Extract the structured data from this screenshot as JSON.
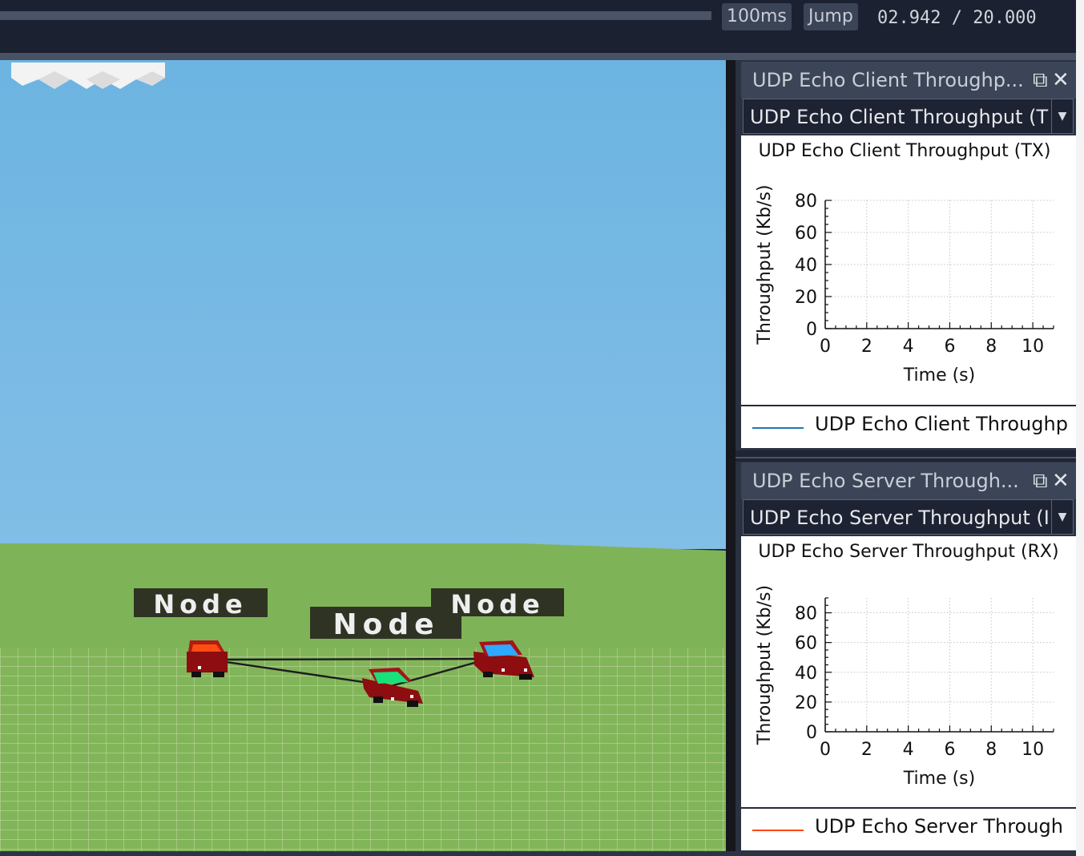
{
  "toolbar": {
    "step_label": "100ms",
    "jump_label": "Jump",
    "time_readout": "02.942 / 20.000"
  },
  "scene": {
    "node_labels": [
      "Node",
      "Node",
      "Node"
    ],
    "sky_color": "#74b6e3",
    "ground_color": "#7fb358"
  },
  "panels": [
    {
      "header": "UDP Echo Client Throughp...",
      "dropdown_value": "UDP Echo Client Throughput (T",
      "legend_label": "UDP Echo Client Throughp",
      "legend_color": "#1f77b4"
    },
    {
      "header": "UDP Echo Server Through...",
      "dropdown_value": "UDP Echo Server Throughput (I",
      "legend_label": "UDP Echo Server Through",
      "legend_color": "#ff4500"
    }
  ],
  "icons": {
    "float": "float-window-icon",
    "close": "close-icon",
    "dropdown": "chevron-down-icon"
  },
  "chart_data": [
    {
      "type": "line",
      "title": "UDP Echo Client Throughput (TX)",
      "xlabel": "Time (s)",
      "ylabel": "Throughput (Kb/s)",
      "xlim": [
        0,
        11
      ],
      "ylim": [
        0,
        80
      ],
      "xticks": [
        "0",
        "2",
        "4",
        "6",
        "8",
        "10"
      ],
      "yticks": [
        "0",
        "20",
        "40",
        "60",
        "80"
      ],
      "grid": true,
      "series": [
        {
          "name": "UDP Echo Client Throughp",
          "x": [],
          "y": []
        }
      ]
    },
    {
      "type": "line",
      "title": "UDP Echo Server Throughput (RX)",
      "xlabel": "Time (s)",
      "ylabel": "Throughput (Kb/s)",
      "xlim": [
        0,
        11
      ],
      "ylim": [
        0,
        90
      ],
      "xticks": [
        "0",
        "2",
        "4",
        "6",
        "8",
        "10"
      ],
      "yticks": [
        "0",
        "20",
        "40",
        "60",
        "80"
      ],
      "grid": true,
      "series": [
        {
          "name": "UDP Echo Server Through",
          "x": [],
          "y": []
        }
      ]
    }
  ]
}
